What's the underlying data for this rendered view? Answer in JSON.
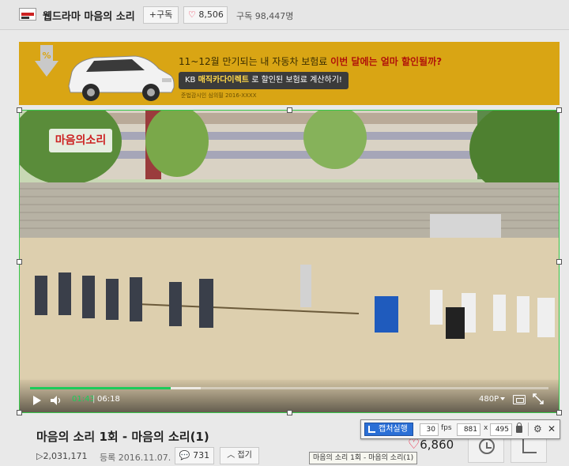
{
  "header": {
    "channel_name": "웹드라마 마음의 소리",
    "subscribe_label": "+구독",
    "like_count": "8,506",
    "subscriber_text": "구독 98,447명"
  },
  "ad": {
    "headline_prefix": "11~12월 만기되는 내 자동차 보험료 ",
    "headline_highlight": "이번 달에는 얼마 할인될까?",
    "pill_prefix": "KB ",
    "pill_brand": "매직카다이렉트",
    "pill_suffix": " 로 할인된 보험료 계산하기!",
    "fine_print": "준법감시인 심의필 2016-XXXX"
  },
  "player": {
    "overlay_logo": "마음의소리",
    "current_time": "01:43",
    "separator": "|",
    "duration": "06:18",
    "quality": "480P",
    "progress_fraction": 0.272
  },
  "video_info": {
    "title": "마음의 소리 1회 - 마음의 소리(1)",
    "views": "▷2,031,171",
    "registered": "등록  2016.11.07.",
    "comment_count": "731",
    "fold_label": "접기",
    "like_count": "6,860"
  },
  "capture_toolbar": {
    "capture_label": "캡처실행",
    "fps_value": "30",
    "fps_label": "fps",
    "width_value": "881",
    "x_label": "x",
    "height_value": "495"
  },
  "tooltip": "마음의 소리 1회 - 마음의 소리(1)",
  "colors": {
    "accent_green": "#1dcb5a",
    "like_red": "#e22244",
    "ad_yellow": "#d9a514",
    "capture_blue": "#2a6fd6"
  }
}
